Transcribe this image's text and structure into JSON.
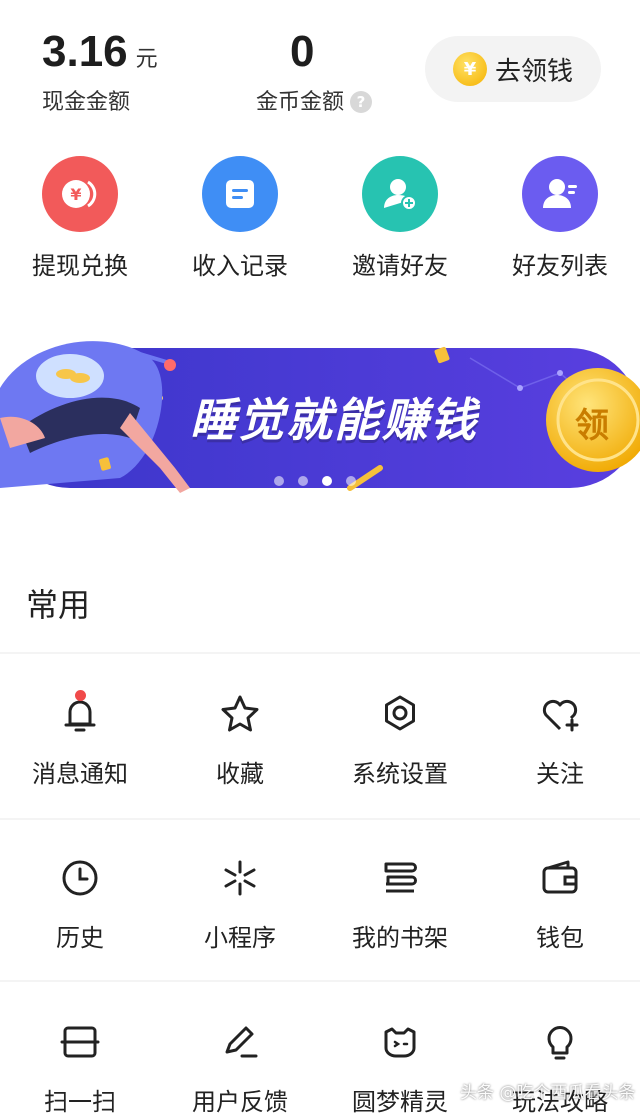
{
  "balance": {
    "cash": {
      "value": "3.16",
      "unit": "元",
      "label": "现金金额"
    },
    "coins": {
      "value": "0",
      "label": "金币金额",
      "help": "?"
    },
    "claim_button": {
      "label": "去领钱",
      "coin_glyph": "¥"
    }
  },
  "quick_actions": [
    {
      "label": "提现兑换",
      "icon": "withdraw-icon",
      "color": "#f25a5a"
    },
    {
      "label": "收入记录",
      "icon": "record-icon",
      "color": "#3f8ef5"
    },
    {
      "label": "邀请好友",
      "icon": "invite-icon",
      "color": "#27c3b1"
    },
    {
      "label": "好友列表",
      "icon": "friends-icon",
      "color": "#6b5cf0"
    }
  ],
  "banner": {
    "text": "睡觉就能赚钱",
    "coin_text": "领",
    "slide_count": 4,
    "active_slide": 3,
    "colors": {
      "bg": "#4b3ed6",
      "coin": "#f5b400"
    }
  },
  "common": {
    "title": "常用",
    "rows": [
      [
        {
          "label": "消息通知",
          "icon": "bell-icon",
          "dot": true
        },
        {
          "label": "收藏",
          "icon": "star-icon"
        },
        {
          "label": "系统设置",
          "icon": "gear-icon"
        },
        {
          "label": "关注",
          "icon": "heart-plus-icon"
        }
      ],
      [
        {
          "label": "历史",
          "icon": "clock-icon"
        },
        {
          "label": "小程序",
          "icon": "mini-program-icon"
        },
        {
          "label": "我的书架",
          "icon": "bookshelf-icon"
        },
        {
          "label": "钱包",
          "icon": "wallet-icon"
        }
      ],
      [
        {
          "label": "扫一扫",
          "icon": "scan-icon"
        },
        {
          "label": "用户反馈",
          "icon": "feedback-icon"
        },
        {
          "label": "圆梦精灵",
          "icon": "spirit-icon"
        },
        {
          "label": "玩法攻略",
          "icon": "lightbulb-icon"
        }
      ]
    ]
  },
  "watermark": "头条 @吃个西瓜看头条"
}
